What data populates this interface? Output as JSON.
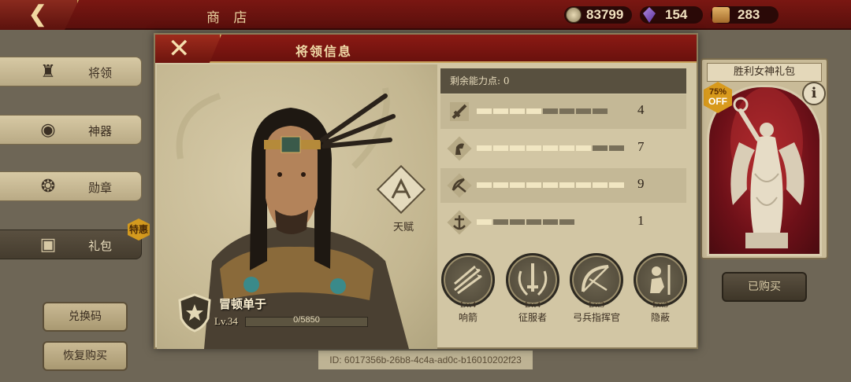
{
  "topbar": {
    "back_icon": "back-arrow-icon",
    "title": "商 店"
  },
  "resources": {
    "coins": "83799",
    "gems": "154",
    "tickets": "283"
  },
  "sidebar": {
    "items": [
      {
        "label": "将领",
        "icon": "spartan-helmet-icon"
      },
      {
        "label": "神器",
        "icon": "eye-of-horus-icon"
      },
      {
        "label": "勋章",
        "icon": "eagle-medal-icon"
      },
      {
        "label": "礼包",
        "icon": "chest-icon",
        "badge": "特惠",
        "active": true
      }
    ],
    "redeem_label": "兑换码",
    "restore_label": "恢复购买"
  },
  "gift": {
    "title": "胜利女神礼包",
    "discount_pct": "75%",
    "discount_off": "OFF",
    "info": "i",
    "bought_label": "已购买"
  },
  "footer": {
    "id_text": "ID: 6017356b-26b8-4c4a-ad0c-b16010202f23"
  },
  "dialog": {
    "title": "将领信息",
    "close_icon": "close-x-icon",
    "talent_label": "天赋",
    "general": {
      "name": "冒顿单于",
      "level": "Lv.34",
      "xp_text": "0/5850",
      "xp_fraction": 0.0
    },
    "points_text": "剩余能力点: 0",
    "stats": [
      {
        "icon": "sword-icon",
        "value": "4",
        "filled": 4,
        "total": 8
      },
      {
        "icon": "horse-icon",
        "value": "7",
        "filled": 7,
        "total": 9
      },
      {
        "icon": "bow-icon",
        "value": "9",
        "filled": 9,
        "total": 9
      },
      {
        "icon": "anchor-icon",
        "value": "1",
        "filled": 1,
        "total": 6
      }
    ],
    "skills": [
      {
        "level": "Lv.4",
        "name": "响箭",
        "icon": "whistling-arrows-icon"
      },
      {
        "level": "Lv.4",
        "name": "征服者",
        "icon": "laurel-sword-icon"
      },
      {
        "level": "Lv.3",
        "name": "弓兵指挥官",
        "icon": "bow-arrow-icon"
      },
      {
        "level": "Lv.3",
        "name": "隐蔽",
        "icon": "hidden-soldier-icon"
      }
    ]
  }
}
